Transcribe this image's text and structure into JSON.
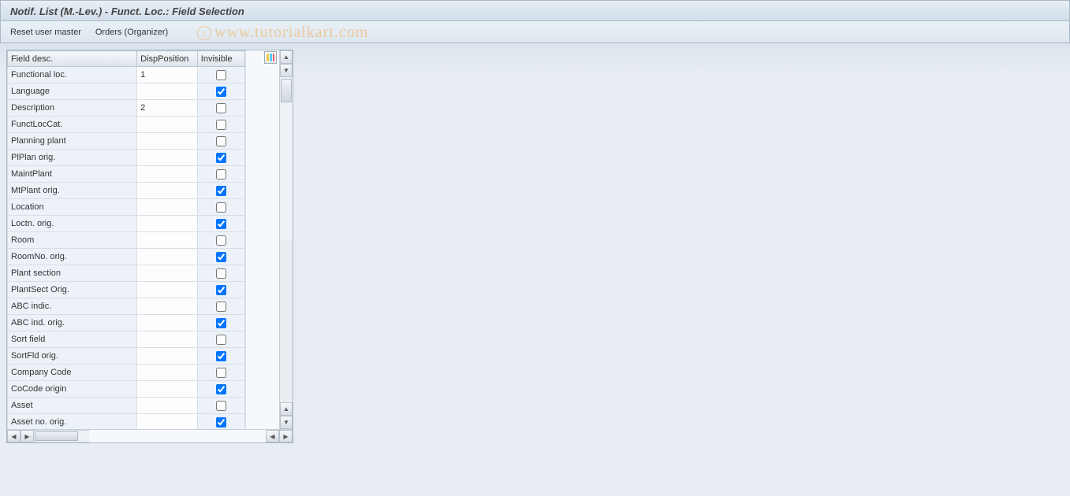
{
  "window": {
    "title": "Notif. List (M.-Lev.) - Funct. Loc.: Field Selection"
  },
  "toolbar": {
    "reset_label": "Reset user master",
    "orders_label": "Orders (Organizer)"
  },
  "watermark": {
    "text": "www.tutorialkart.com"
  },
  "table": {
    "headers": {
      "field_desc": "Field desc.",
      "disp_position": "DispPosition",
      "invisible": "Invisible"
    },
    "rows": [
      {
        "label": "Functional loc.",
        "pos": "1",
        "invisible": false
      },
      {
        "label": "Language",
        "pos": "",
        "invisible": true
      },
      {
        "label": "Description",
        "pos": "2",
        "invisible": false
      },
      {
        "label": "FunctLocCat.",
        "pos": "",
        "invisible": false
      },
      {
        "label": "Planning plant",
        "pos": "",
        "invisible": false
      },
      {
        "label": "PlPlan orig.",
        "pos": "",
        "invisible": true
      },
      {
        "label": "MaintPlant",
        "pos": "",
        "invisible": false
      },
      {
        "label": "MtPlant orig.",
        "pos": "",
        "invisible": true
      },
      {
        "label": "Location",
        "pos": "",
        "invisible": false
      },
      {
        "label": "Loctn. orig.",
        "pos": "",
        "invisible": true
      },
      {
        "label": "Room",
        "pos": "",
        "invisible": false
      },
      {
        "label": "RoomNo. orig.",
        "pos": "",
        "invisible": true
      },
      {
        "label": "Plant section",
        "pos": "",
        "invisible": false
      },
      {
        "label": "PlantSect Orig.",
        "pos": "",
        "invisible": true
      },
      {
        "label": "ABC indic.",
        "pos": "",
        "invisible": false
      },
      {
        "label": "ABC ind. orig.",
        "pos": "",
        "invisible": true
      },
      {
        "label": "Sort field",
        "pos": "",
        "invisible": false
      },
      {
        "label": "SortFld orig.",
        "pos": "",
        "invisible": true
      },
      {
        "label": "Company Code",
        "pos": "",
        "invisible": false
      },
      {
        "label": "CoCode origin",
        "pos": "",
        "invisible": true
      },
      {
        "label": "Asset",
        "pos": "",
        "invisible": false
      },
      {
        "label": "Asset no. orig.",
        "pos": "",
        "invisible": true
      }
    ]
  }
}
